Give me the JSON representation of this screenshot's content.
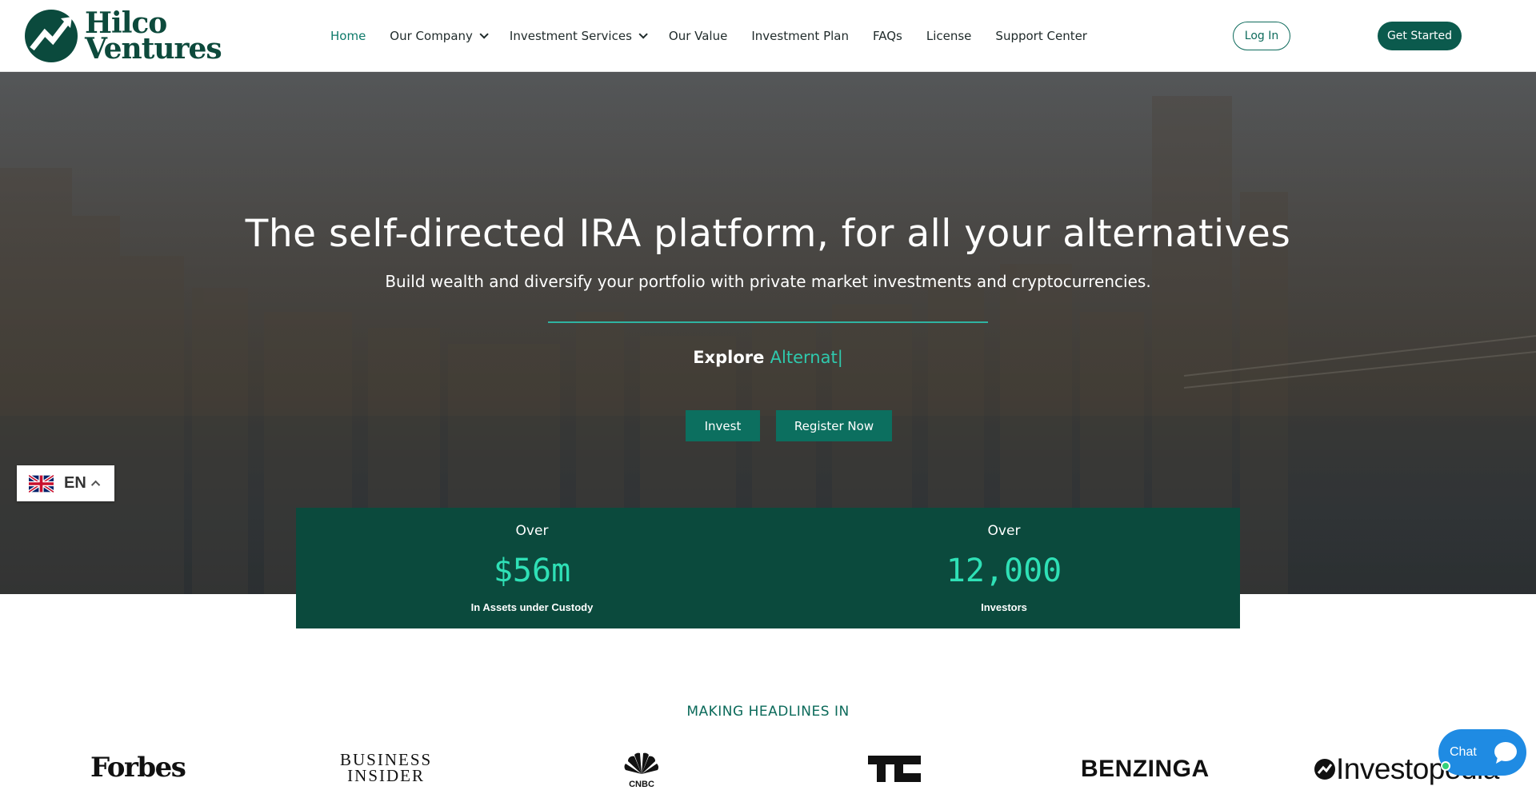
{
  "brand": {
    "name_line1": "Hilco",
    "name_line2": "Ventures",
    "color": "#0b4a3d",
    "accent": "#2fc9ad"
  },
  "nav": {
    "items": [
      {
        "label": "Home",
        "active": true,
        "dropdown": false
      },
      {
        "label": "Our Company",
        "active": false,
        "dropdown": true
      },
      {
        "label": "Investment Services",
        "active": false,
        "dropdown": true
      },
      {
        "label": "Our Value",
        "active": false,
        "dropdown": false
      },
      {
        "label": "Investment Plan",
        "active": false,
        "dropdown": false
      },
      {
        "label": "FAQs",
        "active": false,
        "dropdown": false
      },
      {
        "label": "License",
        "active": false,
        "dropdown": false
      },
      {
        "label": "Support Center",
        "active": false,
        "dropdown": false
      }
    ],
    "login_label": "Log In",
    "get_started_label": "Get Started"
  },
  "hero": {
    "title": "The self-directed IRA platform, for all your alternatives",
    "subtitle": "Build wealth and diversify your portfolio with private market investments and cryptocurrencies.",
    "explore_prefix": "Explore",
    "explore_word": "Alternat",
    "cursor": "|",
    "invest_label": "Invest",
    "register_label": "Register Now"
  },
  "language": {
    "code": "EN",
    "flag": "uk-flag-icon"
  },
  "stats": [
    {
      "over": "Over",
      "value": "$56m",
      "label": "In Assets under Custody"
    },
    {
      "over": "Over",
      "value": "12,000",
      "label": "Investors"
    }
  ],
  "headlines": {
    "title": "MAKING HEADLINES IN",
    "logos": {
      "forbes": "Forbes",
      "bi_line1": "BUSINESS",
      "bi_line2": "INSIDER",
      "cnbc": "CNBC",
      "benzinga": "BENZINGA",
      "investopedia": "Investopedia"
    }
  },
  "chat": {
    "label": "Chat"
  }
}
